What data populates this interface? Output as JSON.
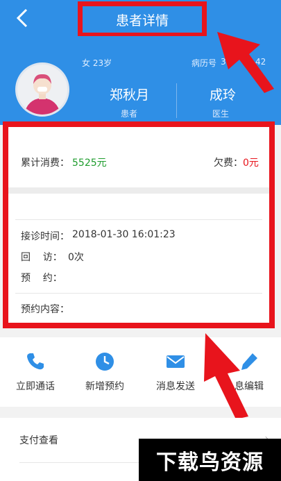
{
  "header": {
    "title": "患者详情"
  },
  "patient": {
    "gender_age": "女 23岁",
    "record_label": "病历号",
    "record_value": "3",
    "record_suffix": "42",
    "name": "郑秋月",
    "name_role": "患者",
    "doctor": "成玲",
    "doctor_role": "医生"
  },
  "billing": {
    "total_label": "累计消费：",
    "total_value": "5525元",
    "debt_label": "欠费：",
    "debt_value": "0元"
  },
  "visit": {
    "time_label": "接诊时间：",
    "time_value": "2018-01-30 16:01:23",
    "followup_label": "回    访：",
    "followup_value": "0次",
    "appointment_label": "预    约：",
    "appointment_value": "",
    "content_label": "预约内容："
  },
  "actions": [
    {
      "label": "立即通话",
      "icon": "phone-icon"
    },
    {
      "label": "新增预约",
      "icon": "clock-icon"
    },
    {
      "label": "消息发送",
      "icon": "mail-icon"
    },
    {
      "label": "息编辑",
      "icon": "pencil-icon"
    }
  ],
  "list": [
    {
      "label": "支付查看"
    }
  ],
  "watermark": {
    "text": "下载鸟资源"
  },
  "colors": {
    "primary": "#2f8fe6",
    "highlight": "#e8141c",
    "green": "#1e9c2d"
  }
}
